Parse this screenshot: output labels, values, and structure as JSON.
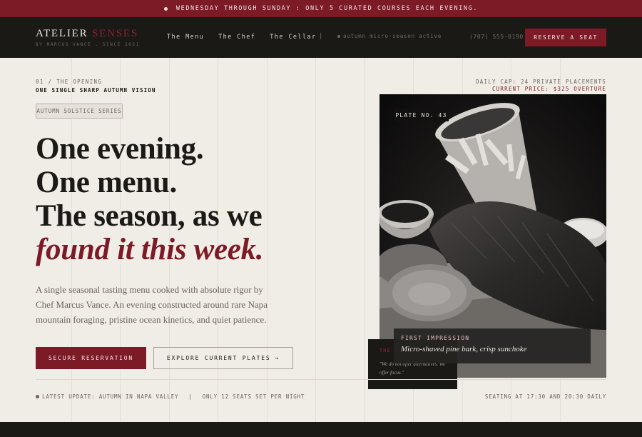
{
  "announcement": {
    "text": "WEDNESDAY THROUGH SUNDAY : ONLY 5 CURATED COURSES EACH EVENING."
  },
  "brand": {
    "name_main": "ATELIER ",
    "name_accent": "SENSES",
    "subtitle": "BY MARCUS VANCE . SINCE 2021"
  },
  "nav": {
    "links": [
      "The Menu",
      "The Chef",
      "The Cellar"
    ],
    "separator": "|",
    "status": "autumn micro-season active",
    "phone": "(707) 555-0190",
    "cta": "RESERVE A SEAT"
  },
  "hero": {
    "kicker": "01 / THE OPENING",
    "kicker_sub": "ONE SINGLE SHARP AUTUMN VISION",
    "tag": "AUTUMN SOLSTICE SERIES",
    "headline_lines": [
      "One evening.",
      "One menu.",
      "The season, as we"
    ],
    "headline_emphasis": "found it this week.",
    "lede": "A single seasonal tasting menu cooked with absolute rigor by Chef Marcus Vance. An evening constructed around rare Napa mountain foraging, pristine ocean kinetics, and quiet patience.",
    "primary_button": "SECURE RESERVATION",
    "secondary_button": "EXPLORE CURRENT PLATES",
    "secondary_arrow": "→"
  },
  "capacity": {
    "line1": "DAILY CAP: 24 PRIVATE PLACEMENTS",
    "line2": "CURRENT PRICE: $325 OVERTURE"
  },
  "feature_card": {
    "plate_badge": "PLATE NO. 43",
    "caption_title": "FIRST IMPRESSION",
    "caption_desc": "Micro-shaved pine bark, crisp sunchoke",
    "quote_heading": "THE P",
    "quote_text": "\"We do not offer alternatives. We offer focus.\""
  },
  "footer_strip": {
    "update": "LATEST UPDATE: AUTUMN IN NAPA VALLEY",
    "separator": "|",
    "seats": "ONLY 12 SEATS SET PER NIGHT",
    "seating": "SEATING AT 17:30 AND 20:30 DAILY"
  },
  "colors": {
    "accent": "#7c1a26",
    "dark": "#1b1915",
    "paper": "#f0ece6"
  }
}
